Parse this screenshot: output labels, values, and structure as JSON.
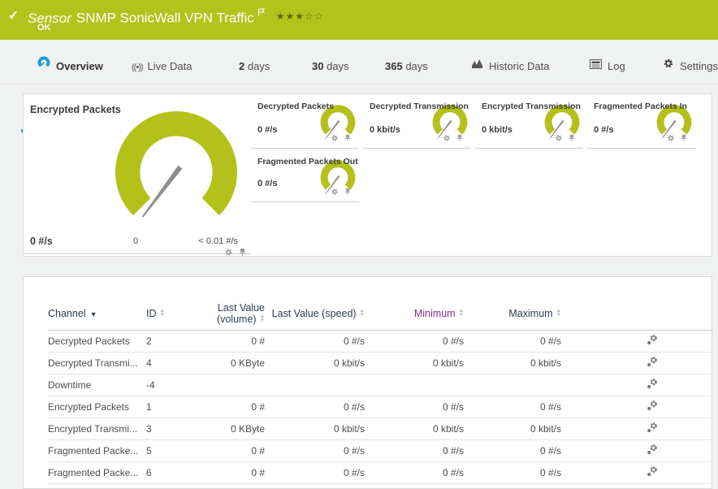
{
  "colors": {
    "status_green": "#b4c21c",
    "gauge_green": "#b3c11a",
    "accent_blue": "#1b9dd9",
    "table_header_text": "#2e3b52",
    "minimum_header_text": "#7b2e8a",
    "needle_gray": "#8f8f8f"
  },
  "header": {
    "check_icon": "✓",
    "sensor_label": "Sensor",
    "title": "SNMP SonicWall VPN Traffic",
    "status": "OK",
    "flag_icon": "flag-outline",
    "rating": {
      "filled": "★★★",
      "empty": "☆☆",
      "filled_count": 3,
      "total": 5
    }
  },
  "tabs": [
    {
      "label": "Overview",
      "icon": "gauge-icon",
      "active": true
    },
    {
      "label": "Live Data",
      "icon": "broadcast-icon",
      "broadcast_glyph": "((•))"
    },
    {
      "strong": "2",
      "label": "days"
    },
    {
      "strong": "30",
      "label": "days"
    },
    {
      "strong": "365",
      "label": "days"
    },
    {
      "label": "Historic Data",
      "icon": "area-chart-icon"
    },
    {
      "label": "Log",
      "icon": "log-list-icon"
    },
    {
      "label": "Settings",
      "icon": "gear-icon"
    }
  ],
  "gauges": {
    "big": {
      "title": "Encrypted Packets",
      "value": "0 #/s",
      "scale_min": "0",
      "scale_max": "< 0.01 #/s"
    },
    "small": [
      {
        "title": "Decrypted Packets",
        "value": "0 #/s"
      },
      {
        "title": "Decrypted Transmission",
        "value": "0 kbit/s"
      },
      {
        "title": "Encrypted Transmission",
        "value": "0 kbit/s"
      },
      {
        "title": "Fragmented Packets In",
        "value": "0 #/s"
      },
      {
        "title": "Fragmented Packets Out",
        "value": "0 #/s"
      }
    ],
    "tile_icons": [
      "gear-icon",
      "pin-icon"
    ]
  },
  "table": {
    "headers": {
      "channel": "Channel",
      "id": "ID",
      "volume": "Last Value (volume)",
      "speed": "Last Value (speed)",
      "min": "Minimum",
      "max": "Maximum"
    },
    "sort": {
      "active_column": "channel",
      "direction": "desc"
    },
    "row_action_icon": "channel-settings-icon",
    "rows": [
      {
        "channel": "Decrypted Packets",
        "id": "2",
        "volume": "0 #",
        "speed": "0 #/s",
        "min": "0 #/s",
        "max": "0 #/s"
      },
      {
        "channel": "Decrypted Transmi...",
        "id": "4",
        "volume": "0 KByte",
        "speed": "0 kbit/s",
        "min": "0 kbit/s",
        "max": "0 kbit/s"
      },
      {
        "channel": "Downtime",
        "id": "-4",
        "volume": "",
        "speed": "",
        "min": "",
        "max": ""
      },
      {
        "channel": "Encrypted Packets",
        "id": "1",
        "volume": "0 #",
        "speed": "0 #/s",
        "min": "0 #/s",
        "max": "0 #/s"
      },
      {
        "channel": "Encrypted Transmi...",
        "id": "3",
        "volume": "0 KByte",
        "speed": "0 kbit/s",
        "min": "0 kbit/s",
        "max": "0 kbit/s"
      },
      {
        "channel": "Fragmented Packe...",
        "id": "5",
        "volume": "0 #",
        "speed": "0 #/s",
        "min": "0 #/s",
        "max": "0 #/s"
      },
      {
        "channel": "Fragmented Packe...",
        "id": "6",
        "volume": "0 #",
        "speed": "0 #/s",
        "min": "0 #/s",
        "max": "0 #/s"
      }
    ]
  }
}
